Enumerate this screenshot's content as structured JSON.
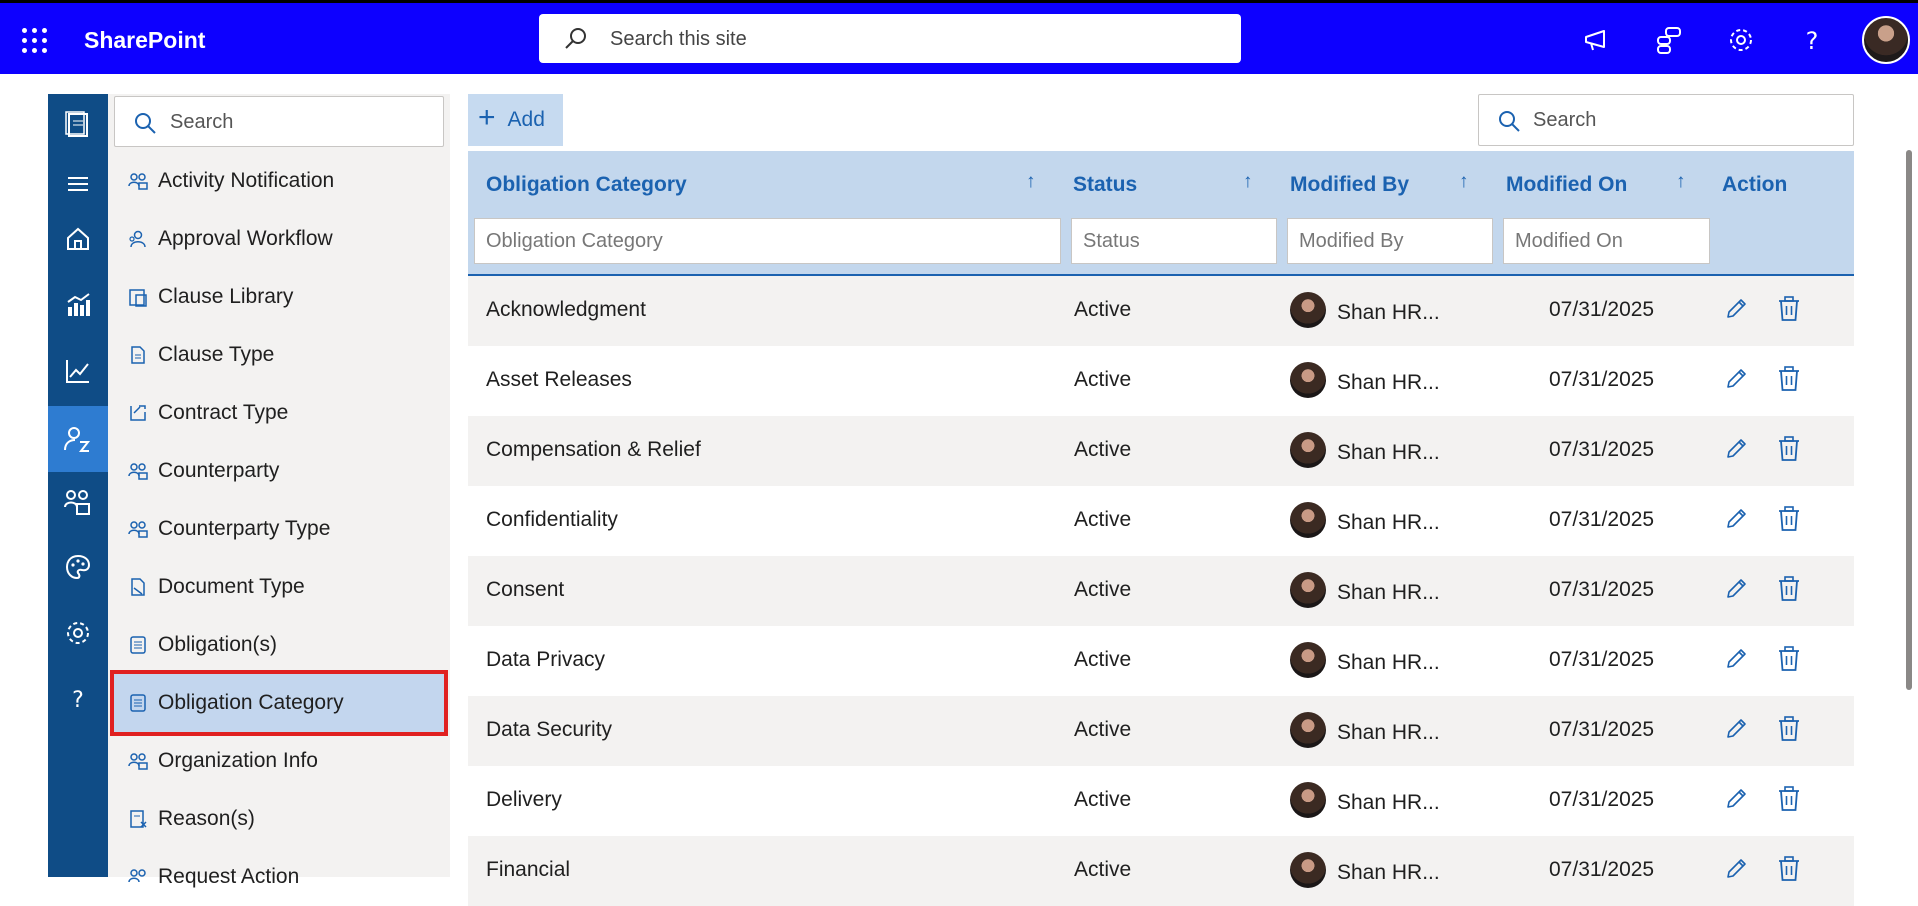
{
  "app": {
    "brand": "SharePoint",
    "site_search_placeholder": "Search this site"
  },
  "topbar_icons": [
    "megaphone-icon",
    "org-icon",
    "gear-icon",
    "help-icon"
  ],
  "rail_icons": [
    "pages-icon",
    "menu-icon",
    "home-icon",
    "analytics-icon",
    "chart-icon",
    "user-settings-icon",
    "teams-icon",
    "palette-icon",
    "gear-icon",
    "help-icon"
  ],
  "left_panel": {
    "search_placeholder": "Search",
    "items": [
      {
        "label": "Activity Notification",
        "icon": "people-icon"
      },
      {
        "label": "Approval Workflow",
        "icon": "person-flow-icon"
      },
      {
        "label": "Clause Library",
        "icon": "library-icon"
      },
      {
        "label": "Clause Type",
        "icon": "document-icon"
      },
      {
        "label": "Contract Type",
        "icon": "contract-icon"
      },
      {
        "label": "Counterparty",
        "icon": "people-icon"
      },
      {
        "label": "Counterparty Type",
        "icon": "people-icon"
      },
      {
        "label": "Document Type",
        "icon": "document-type-icon"
      },
      {
        "label": "Obligation(s)",
        "icon": "list-icon"
      },
      {
        "label": "Obligation Category",
        "icon": "list-icon",
        "selected": true
      },
      {
        "label": "Organization Info",
        "icon": "people-icon"
      },
      {
        "label": "Reason(s)",
        "icon": "reason-icon"
      },
      {
        "label": "Request Action",
        "icon": "people-icon"
      }
    ]
  },
  "toolbar": {
    "add_label": "Add",
    "search_placeholder": "Search"
  },
  "table": {
    "columns": [
      {
        "label": "Obligation Category",
        "sort": "↑",
        "filter_placeholder": "Obligation Category"
      },
      {
        "label": "Status",
        "sort": "↑",
        "filter_placeholder": "Status"
      },
      {
        "label": "Modified By",
        "sort": "↑",
        "filter_placeholder": "Modified By"
      },
      {
        "label": "Modified On",
        "sort": "↑",
        "filter_placeholder": "Modified On"
      },
      {
        "label": "Action"
      }
    ],
    "rows": [
      {
        "category": "Acknowledgment",
        "status": "Active",
        "modified_by": "Shan HR...",
        "modified_on": "07/31/2025"
      },
      {
        "category": "Asset Releases",
        "status": "Active",
        "modified_by": "Shan HR...",
        "modified_on": "07/31/2025"
      },
      {
        "category": "Compensation & Relief",
        "status": "Active",
        "modified_by": "Shan HR...",
        "modified_on": "07/31/2025"
      },
      {
        "category": "Confidentiality",
        "status": "Active",
        "modified_by": "Shan HR...",
        "modified_on": "07/31/2025"
      },
      {
        "category": "Consent",
        "status": "Active",
        "modified_by": "Shan HR...",
        "modified_on": "07/31/2025"
      },
      {
        "category": "Data Privacy",
        "status": "Active",
        "modified_by": "Shan HR...",
        "modified_on": "07/31/2025"
      },
      {
        "category": "Data Security",
        "status": "Active",
        "modified_by": "Shan HR...",
        "modified_on": "07/31/2025"
      },
      {
        "category": "Delivery",
        "status": "Active",
        "modified_by": "Shan HR...",
        "modified_on": "07/31/2025"
      },
      {
        "category": "Financial",
        "status": "Active",
        "modified_by": "Shan HR...",
        "modified_on": "07/31/2025"
      }
    ]
  },
  "colors": {
    "suitebar": "#0d00ff",
    "rail": "#0f4c86",
    "accent": "#1b62b0",
    "header_bg": "#c3d7ed",
    "selected_outline": "#e02020"
  }
}
